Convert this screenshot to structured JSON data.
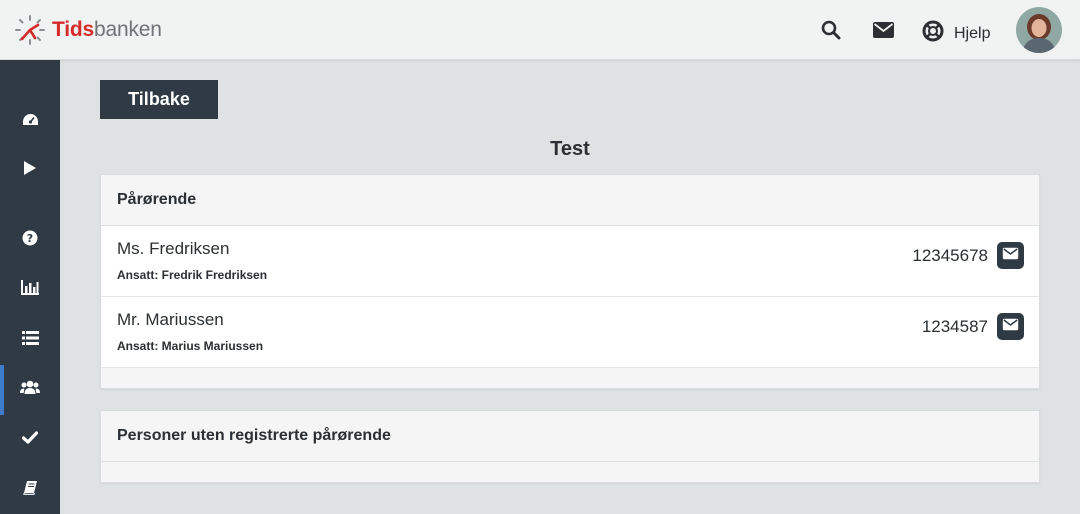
{
  "app": {
    "logo_part1": "Tids",
    "logo_part2": "banken"
  },
  "topbar": {
    "icons": [
      "search-icon",
      "envelope-icon",
      "lifebuoy-icon"
    ],
    "help_label": "Hjelp"
  },
  "sidebar": {
    "items": [
      {
        "icon": "dashboard-icon"
      },
      {
        "icon": "play-icon"
      },
      {
        "icon": "question-circle-icon"
      },
      {
        "icon": "bar-chart-icon"
      },
      {
        "icon": "list-icon"
      },
      {
        "icon": "users-icon",
        "active": true
      },
      {
        "icon": "check-icon"
      },
      {
        "icon": "book-icon"
      }
    ]
  },
  "main": {
    "back_label": "Tilbake",
    "title": "Test",
    "relatives_panel": {
      "title": "Pårørende",
      "rows": [
        {
          "name": "Ms. Fredriksen",
          "employee": "Ansatt: Fredrik Fredriksen",
          "phone": "12345678"
        },
        {
          "name": "Mr. Mariussen",
          "employee": "Ansatt: Marius Mariussen",
          "phone": "1234587"
        }
      ]
    },
    "no_relatives_panel": {
      "title": "Personer uten registrerte pårørende"
    }
  },
  "colors": {
    "accent": "#3e7ccb",
    "sidebar": "#2f3a45",
    "brand_red": "#d62b2b"
  }
}
